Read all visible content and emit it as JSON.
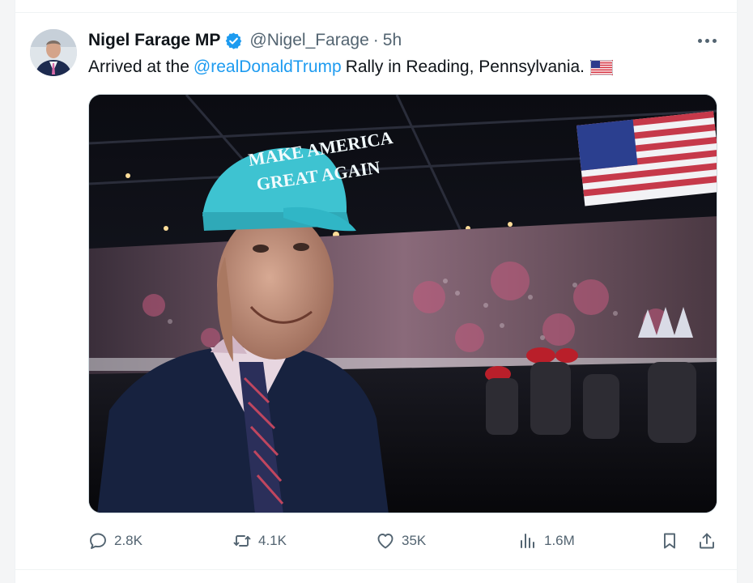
{
  "tweet": {
    "author_name": "Nigel Farage MP",
    "handle": "@Nigel_Farage",
    "separator": "·",
    "time": "5h",
    "text_before": "Arrived at the",
    "mention": "@realDonaldTrump",
    "text_after": "Rally in Reading, Pennsylvania.",
    "flag_icon": "us-flag-emoji",
    "verified_color": "#1d9bf0",
    "link_color": "#1d9bf0"
  },
  "media": {
    "cap_text_line1": "MAKE AMERICA",
    "cap_text_line2": "GREAT AGAIN"
  },
  "actions": {
    "replies": "2.8K",
    "reposts": "4.1K",
    "likes": "35K",
    "views": "1.6M"
  }
}
